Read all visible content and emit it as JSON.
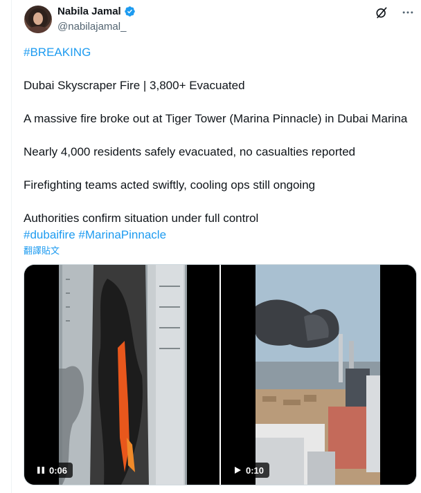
{
  "author": {
    "display_name": "Nabila Jamal",
    "handle": "@nabilajamal_",
    "verified": true
  },
  "post": {
    "paragraphs": [
      "#BREAKING",
      "Dubai Skyscraper Fire | 3,800+ Evacuated",
      "A massive fire broke out at Tiger Tower (Marina Pinnacle) in Dubai Marina",
      "Nearly 4,000 residents safely evacuated, no casualties reported",
      "Firefighting teams acted swiftly, cooling ops still ongoing",
      "Authorities confirm situation under full control"
    ],
    "hashtags": "#dubaifire #MarinaPinnacle",
    "translate_label": "翻譯貼文"
  },
  "media": [
    {
      "kind": "video",
      "state": "playing",
      "icon": "pause-icon",
      "time": "0:06"
    },
    {
      "kind": "video",
      "state": "paused",
      "icon": "play-icon",
      "time": "0:10"
    }
  ],
  "icons": {
    "top_right": [
      "grok-icon",
      "more-icon"
    ]
  },
  "colors": {
    "link": "#1d9bf0",
    "text": "#0f1419",
    "secondary": "#536471",
    "verified_badge": "#1d9bf0"
  }
}
